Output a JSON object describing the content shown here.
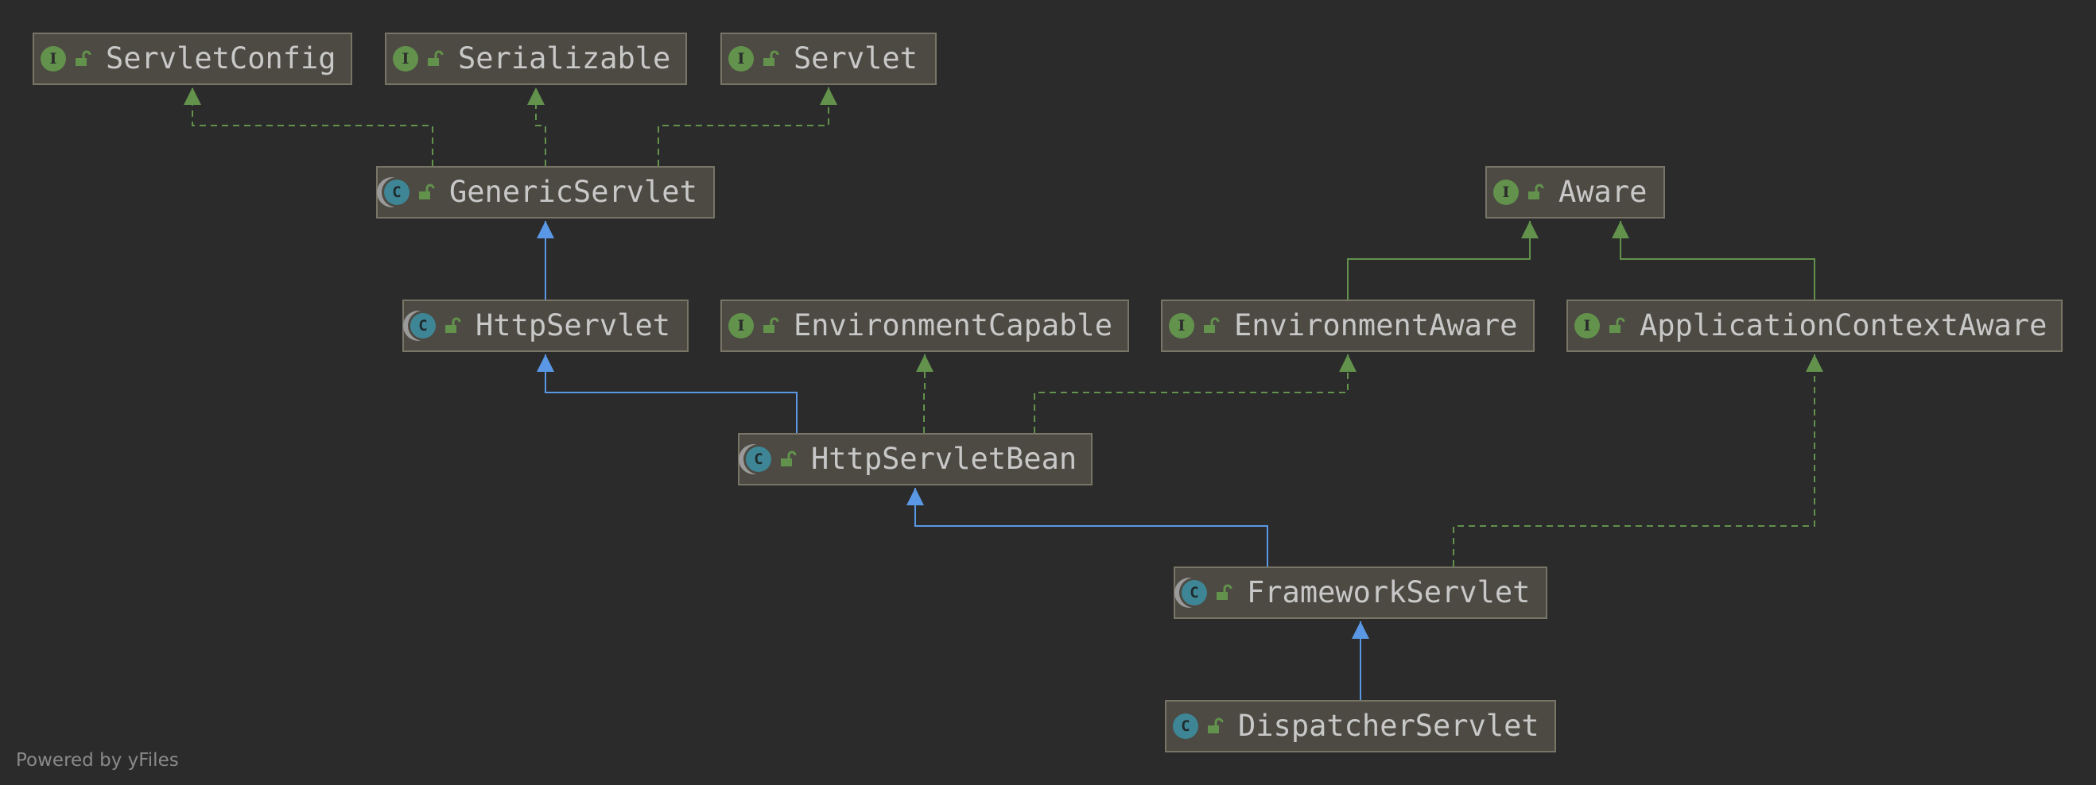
{
  "diagram": {
    "nodes": [
      {
        "id": "ServletConfig",
        "label": "ServletConfig",
        "kind": "interface",
        "kind_glyph": "I"
      },
      {
        "id": "Serializable",
        "label": "Serializable",
        "kind": "interface",
        "kind_glyph": "I"
      },
      {
        "id": "Servlet",
        "label": "Servlet",
        "kind": "interface",
        "kind_glyph": "I"
      },
      {
        "id": "GenericServlet",
        "label": "GenericServlet",
        "kind": "abstract-class",
        "kind_glyph": "C"
      },
      {
        "id": "Aware",
        "label": "Aware",
        "kind": "interface",
        "kind_glyph": "I"
      },
      {
        "id": "HttpServlet",
        "label": "HttpServlet",
        "kind": "abstract-class",
        "kind_glyph": "C"
      },
      {
        "id": "EnvironmentCapable",
        "label": "EnvironmentCapable",
        "kind": "interface",
        "kind_glyph": "I"
      },
      {
        "id": "EnvironmentAware",
        "label": "EnvironmentAware",
        "kind": "interface",
        "kind_glyph": "I"
      },
      {
        "id": "ApplicationContextAware",
        "label": "ApplicationContextAware",
        "kind": "interface",
        "kind_glyph": "I"
      },
      {
        "id": "HttpServletBean",
        "label": "HttpServletBean",
        "kind": "abstract-class",
        "kind_glyph": "C"
      },
      {
        "id": "FrameworkServlet",
        "label": "FrameworkServlet",
        "kind": "abstract-class",
        "kind_glyph": "C"
      },
      {
        "id": "DispatcherServlet",
        "label": "DispatcherServlet",
        "kind": "class",
        "kind_glyph": "C"
      }
    ],
    "edges": [
      {
        "from": "GenericServlet",
        "to": "ServletConfig",
        "type": "implements"
      },
      {
        "from": "GenericServlet",
        "to": "Serializable",
        "type": "implements"
      },
      {
        "from": "GenericServlet",
        "to": "Servlet",
        "type": "implements"
      },
      {
        "from": "HttpServlet",
        "to": "GenericServlet",
        "type": "extends"
      },
      {
        "from": "EnvironmentAware",
        "to": "Aware",
        "type": "extends-interface"
      },
      {
        "from": "ApplicationContextAware",
        "to": "Aware",
        "type": "extends-interface"
      },
      {
        "from": "HttpServletBean",
        "to": "HttpServlet",
        "type": "extends"
      },
      {
        "from": "HttpServletBean",
        "to": "EnvironmentCapable",
        "type": "implements"
      },
      {
        "from": "HttpServletBean",
        "to": "EnvironmentAware",
        "type": "implements"
      },
      {
        "from": "FrameworkServlet",
        "to": "HttpServletBean",
        "type": "extends"
      },
      {
        "from": "FrameworkServlet",
        "to": "ApplicationContextAware",
        "type": "implements"
      },
      {
        "from": "DispatcherServlet",
        "to": "FrameworkServlet",
        "type": "extends"
      }
    ]
  },
  "colors": {
    "background": "#2b2b2b",
    "node_fill": "#4c4a42",
    "extends_line": "#5a98e6",
    "implements_line": "#62924c",
    "interface_badge": "#62924c",
    "class_badge": "#3e8696"
  },
  "footer": {
    "text": "Powered by yFiles"
  }
}
